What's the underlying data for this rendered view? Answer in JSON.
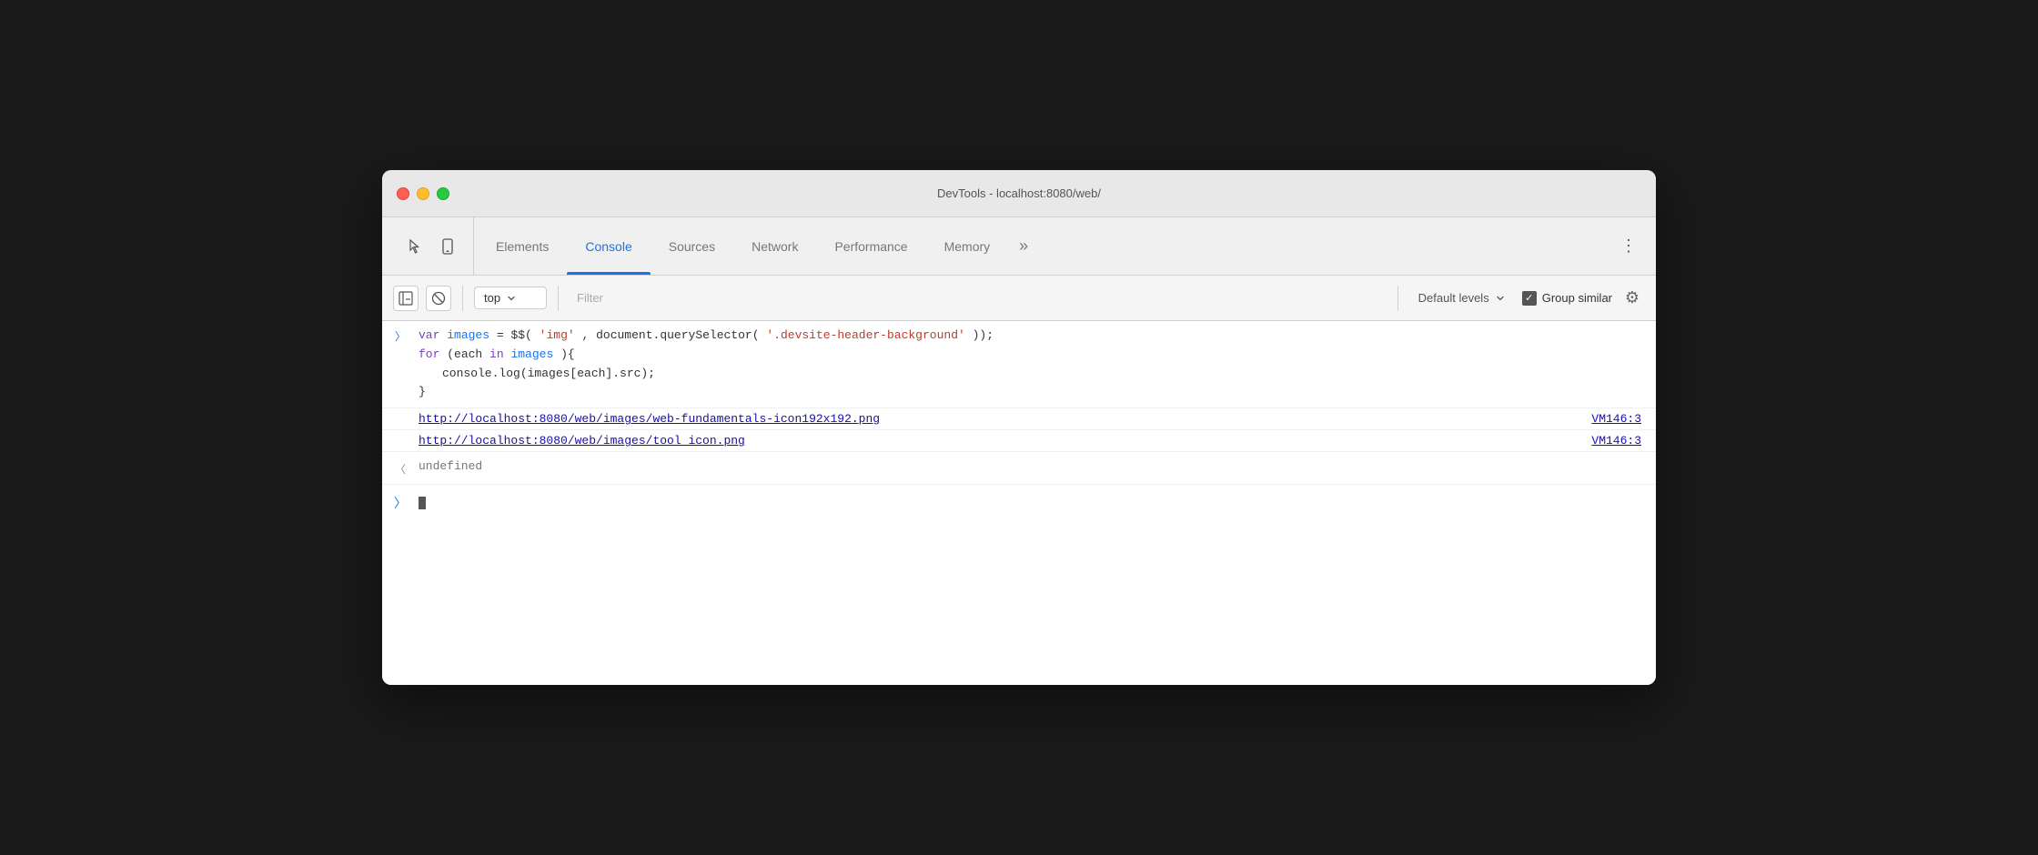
{
  "window": {
    "title": "DevTools - localhost:8080/web/"
  },
  "tabs": [
    {
      "id": "elements",
      "label": "Elements",
      "active": false
    },
    {
      "id": "console",
      "label": "Console",
      "active": true
    },
    {
      "id": "sources",
      "label": "Sources",
      "active": false
    },
    {
      "id": "network",
      "label": "Network",
      "active": false
    },
    {
      "id": "performance",
      "label": "Performance",
      "active": false
    },
    {
      "id": "memory",
      "label": "Memory",
      "active": false
    }
  ],
  "toolbar": {
    "context_label": "top",
    "filter_placeholder": "Filter",
    "levels_label": "Default levels",
    "group_similar_label": "Group similar"
  },
  "console": {
    "code_line1": "var images = $$('img', document.querySelector('.devsite-header-background'));",
    "code_line2": "for (each in images){",
    "code_line3": "    console.log(images[each].src);",
    "code_line4": "}",
    "link1": "http://localhost:8080/web/images/web-fundamentals-icon192x192.png",
    "link1_source": "VM146:3",
    "link2": "http://localhost:8080/web/images/tool_icon.png",
    "link2_source": "VM146:3",
    "undefined_text": "undefined"
  }
}
